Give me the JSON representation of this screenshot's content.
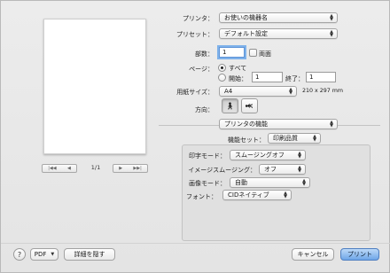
{
  "preview": {
    "page_indicator": "1/1",
    "nav": {
      "first_icon": "first-page-icon",
      "prev_icon": "prev-page-icon",
      "next_icon": "next-page-icon",
      "last_icon": "last-page-icon"
    }
  },
  "printer": {
    "label": "プリンタ：",
    "value": "お使いの機器名"
  },
  "presets": {
    "label": "プリセット：",
    "value": "デフォルト設定"
  },
  "copies": {
    "label": "部数：",
    "value": "1",
    "two_sided_label": "両面"
  },
  "pages": {
    "label": "ページ：",
    "all_label": "すべて",
    "from_label": "開始：",
    "from_value": "1",
    "to_label": "終了：",
    "to_value": "1"
  },
  "paper_size": {
    "label": "用紙サイズ：",
    "value": "A4",
    "dimensions": "210 x 297 mm"
  },
  "orientation": {
    "label": "方向：",
    "portrait_icon": "portrait-icon",
    "landscape_icon": "landscape-icon"
  },
  "panel_popup": {
    "value": "プリンタの機能"
  },
  "feature_set": {
    "label": "機能セット：",
    "value": "印刷品質"
  },
  "features": {
    "print_mode": {
      "label": "印字モード：",
      "value": "スムージングオフ"
    },
    "image_smoothing": {
      "label": "イメージスムージング：",
      "value": "オフ"
    },
    "image_mode": {
      "label": "画像モード：",
      "value": "自動"
    },
    "font": {
      "label": "フォント：",
      "value": "CIDネイティブ"
    }
  },
  "footer": {
    "help_label": "?",
    "pdf_label": "PDF",
    "hide_details_label": "詳細を隠す",
    "cancel_label": "キャンセル",
    "print_label": "プリント"
  }
}
